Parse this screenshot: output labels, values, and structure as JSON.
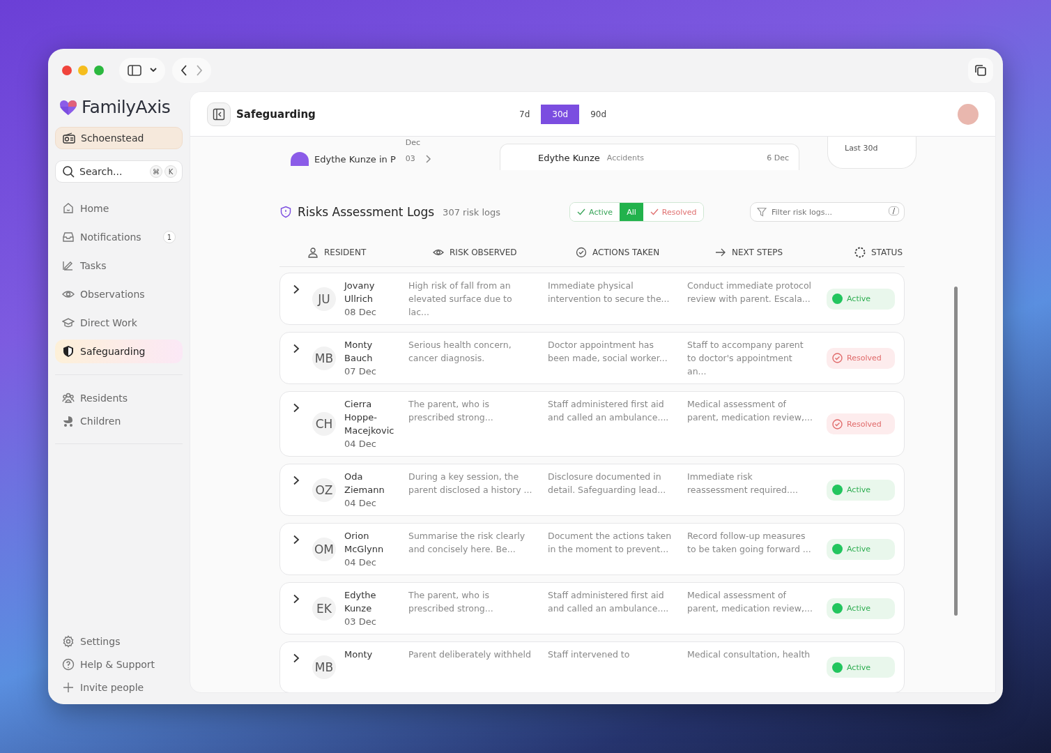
{
  "brand": {
    "name": "FamilyAxis"
  },
  "workspace": {
    "name": "Schoenstead"
  },
  "search": {
    "placeholder": "Search...",
    "keys": [
      "⌘",
      "K"
    ]
  },
  "nav_main": [
    {
      "label": "Home",
      "kind": "home",
      "selected": false
    },
    {
      "label": "Notifications",
      "kind": "inbox",
      "selected": false,
      "badge": "1"
    },
    {
      "label": "Tasks",
      "kind": "edit",
      "selected": false
    },
    {
      "label": "Observations",
      "kind": "eye",
      "selected": false
    },
    {
      "label": "Direct Work",
      "kind": "cap",
      "selected": false
    },
    {
      "label": "Safeguarding",
      "kind": "shield",
      "selected": true
    }
  ],
  "nav_people": [
    {
      "label": "Residents",
      "kind": "people",
      "selected": false
    },
    {
      "label": "Children",
      "kind": "pram",
      "selected": false
    }
  ],
  "nav_footer": [
    {
      "label": "Settings",
      "kind": "gear"
    },
    {
      "label": "Help & Support",
      "kind": "help"
    },
    {
      "label": "Invite people",
      "kind": "plus"
    }
  ],
  "header": {
    "title": "Safeguarding",
    "ranges": [
      {
        "label": "7d",
        "selected": false
      },
      {
        "label": "30d",
        "selected": true
      },
      {
        "label": "90d",
        "selected": false
      }
    ]
  },
  "peek": {
    "list_item": {
      "name": "Edythe Kunze in P",
      "month": "Dec",
      "day": "03"
    },
    "incident": {
      "name": "Edythe Kunze",
      "category": "Accidents",
      "date": "6 Dec"
    },
    "stat": {
      "period": "Last 30d"
    }
  },
  "logs": {
    "title": "Risks Assessment Logs",
    "count": "307 risk logs",
    "filters": [
      {
        "label": "Active",
        "kind": "active",
        "selected": false
      },
      {
        "label": "All",
        "kind": "all",
        "selected": true
      },
      {
        "label": "Resolved",
        "kind": "resolved",
        "selected": false
      }
    ],
    "filter_field": {
      "placeholder": "Filter risk logs...",
      "shortcut": "/"
    },
    "columns": [
      {
        "label": "RESIDENT",
        "kind": "person"
      },
      {
        "label": "RISK OBSERVED",
        "kind": "eye"
      },
      {
        "label": "ACTIONS TAKEN",
        "kind": "check"
      },
      {
        "label": "NEXT STEPS",
        "kind": "arrow"
      },
      {
        "label": "STATUS",
        "kind": "spinner"
      }
    ],
    "rows": [
      {
        "initials": "JU",
        "name": "Jovany Ullrich",
        "date": "08 Dec",
        "risk": "High risk of fall from an elevated surface due to lac...",
        "actions": "Immediate physical intervention to secure the...",
        "next": "Conduct immediate protocol review with parent. Escala...",
        "status": {
          "kind": "active",
          "label": "Active"
        }
      },
      {
        "initials": "MB",
        "name": "Monty Bauch",
        "date": "07 Dec",
        "risk": "Serious health concern, cancer diagnosis.",
        "actions": "Doctor appointment has been made, social worker...",
        "next": "Staff to accompany parent to doctor's appointment an...",
        "status": {
          "kind": "resolved",
          "label": "Resolved"
        }
      },
      {
        "initials": "CH",
        "name": "Cierra Hoppe-Macejkovic",
        "date": "04 Dec",
        "risk": "The parent, who is prescribed strong...",
        "actions": "Staff administered first aid and called an ambulance....",
        "next": "Medical assessment of parent, medication review,...",
        "status": {
          "kind": "resolved",
          "label": "Resolved"
        }
      },
      {
        "initials": "OZ",
        "name": "Oda Ziemann",
        "date": "04 Dec",
        "risk": "During a key session, the parent disclosed a history ...",
        "actions": "Disclosure documented in detail. Safeguarding lead...",
        "next": "Immediate risk reassessment required....",
        "status": {
          "kind": "active",
          "label": "Active"
        }
      },
      {
        "initials": "OM",
        "name": "Orion McGlynn",
        "date": "04 Dec",
        "risk": "Summarise the risk clearly and concisely here. Be...",
        "actions": "Document the actions taken in the moment to prevent...",
        "next": "Record follow-up measures to be taken going forward ...",
        "status": {
          "kind": "active",
          "label": "Active"
        }
      },
      {
        "initials": "EK",
        "name": "Edythe Kunze",
        "date": "03 Dec",
        "risk": "The parent, who is prescribed strong...",
        "actions": "Staff administered first aid and called an ambulance....",
        "next": "Medical assessment of parent, medication review,...",
        "status": {
          "kind": "active",
          "label": "Active"
        }
      },
      {
        "initials": "MB",
        "name": "Monty",
        "risk": "Parent deliberately withheld",
        "actions": "Staff intervened to",
        "next": "Medical consultation, health",
        "status": {
          "kind": "active",
          "label": "Active"
        }
      }
    ]
  }
}
